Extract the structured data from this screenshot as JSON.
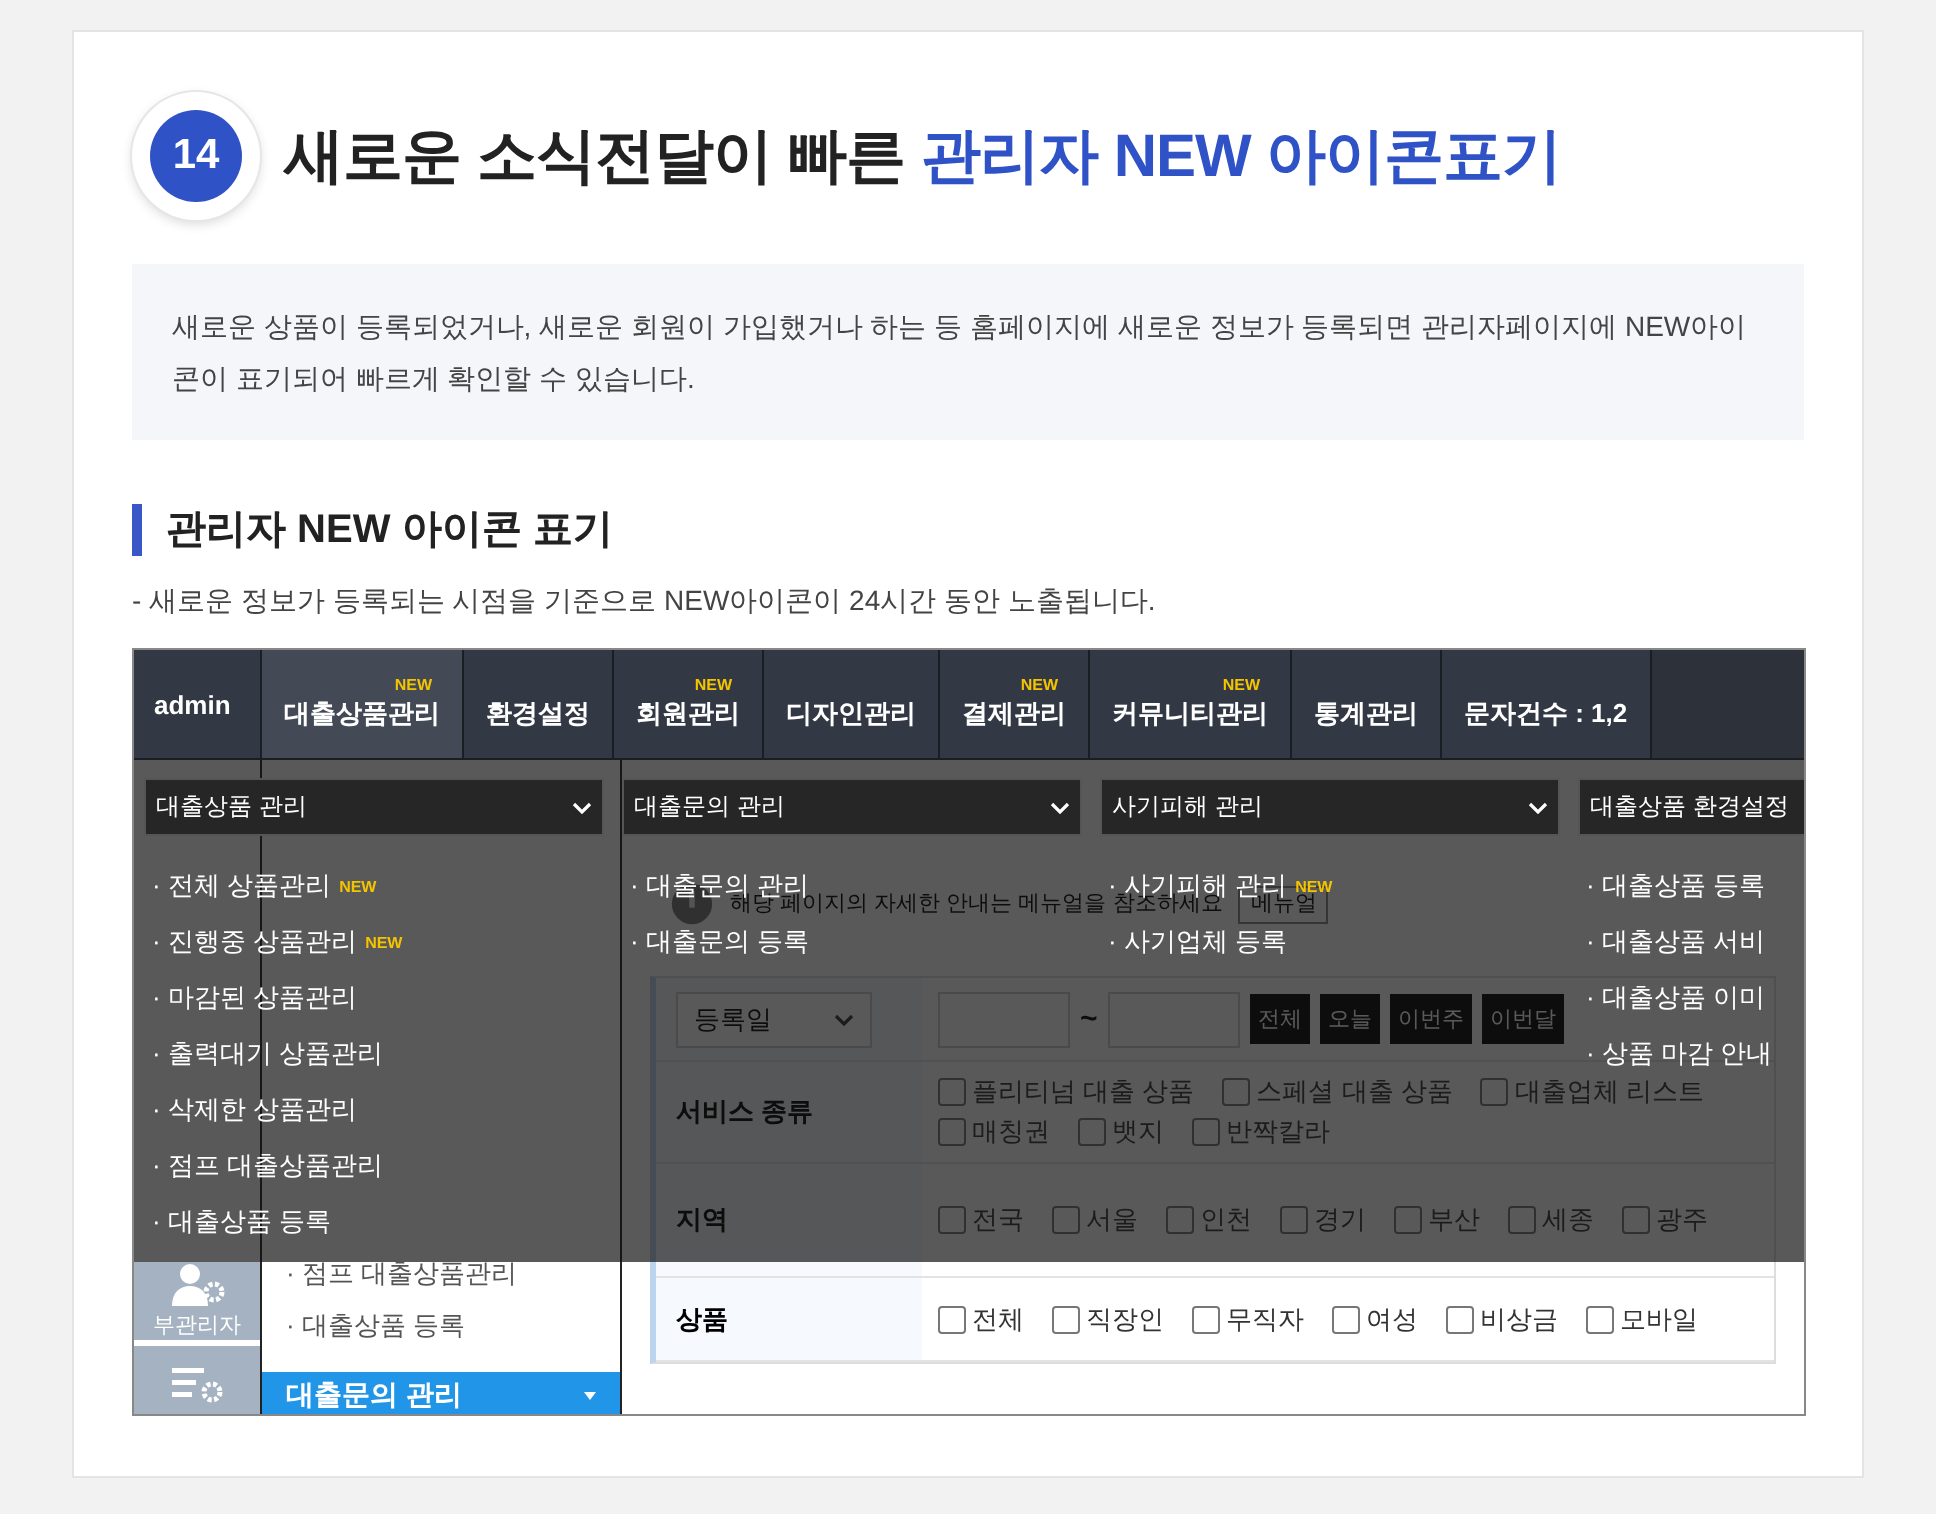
{
  "header": {
    "number": "14",
    "title": "새로운 소식전달이 빠른",
    "title_highlight": "관리자 NEW 아이콘표기"
  },
  "intro": "새로운 상품이 등록되었거나, 새로운 회원이 가입했거나 하는 등 홈페이지에 새로운 정보가 등록되면 관리자페이지에 NEW아이콘이 표기되어 빠르게 확인할 수 있습니다.",
  "section": {
    "heading": "관리자 NEW 아이콘 표기",
    "note": "- 새로운 정보가 등록되는 시점을 기준으로 NEW아이콘이 24시간 동안 노출됩니다."
  },
  "admin_screen": {
    "nav": [
      {
        "label": "admin",
        "kind": "logo",
        "selected": false
      },
      {
        "label": "대출상품관리",
        "kind": "menu",
        "badge": "NEW",
        "selected": true
      },
      {
        "label": "환경설정",
        "kind": "menu",
        "selected": false
      },
      {
        "label": "회원관리",
        "kind": "menu",
        "badge": "NEW",
        "selected": false
      },
      {
        "label": "디자인관리",
        "kind": "menu",
        "selected": false
      },
      {
        "label": "결제관리",
        "kind": "menu",
        "badge": "NEW",
        "selected": false
      },
      {
        "label": "커뮤니티관리",
        "kind": "menu",
        "badge": "NEW",
        "selected": false
      },
      {
        "label": "통계관리",
        "kind": "menu",
        "selected": false
      },
      {
        "label": "문자건수 : 1,2",
        "kind": "menu",
        "selected": false
      }
    ],
    "side_icons": [
      {
        "label": "부관리자",
        "kind": "admin"
      },
      {
        "kind": "settings-list"
      }
    ],
    "sidebar": {
      "items": [
        "· 점프 대출상품관리",
        "· 대출상품 등록"
      ],
      "group": "대출문의 관리"
    },
    "guide": {
      "text": "해당 페이지의 자세한 안내는 메뉴얼을 참조하세요",
      "button": "메뉴얼"
    },
    "form": [
      {
        "kind": "date",
        "select": "등록일",
        "separator": "~",
        "buttons": [
          "전체",
          "오늘",
          "이번주",
          "이번달"
        ]
      },
      {
        "kind": "checks",
        "label": "서비스 종류",
        "options": [
          {
            "label": "플리티넘 대출 상품",
            "checked": false
          },
          {
            "label": "스페셜 대출 상품",
            "checked": false
          },
          {
            "label": "대출업체 리스트",
            "checked": false
          },
          {
            "label": "매칭권",
            "checked": false
          },
          {
            "label": "뱃지",
            "checked": false
          },
          {
            "label": "반짝칼라",
            "checked": false
          }
        ]
      },
      {
        "kind": "checks",
        "label": "지역",
        "options": [
          {
            "label": "전국",
            "checked": false
          },
          {
            "label": "서울",
            "checked": false
          },
          {
            "label": "인천",
            "checked": false
          },
          {
            "label": "경기",
            "checked": false
          },
          {
            "label": "부산",
            "checked": false
          },
          {
            "label": "세종",
            "checked": false
          },
          {
            "label": "광주",
            "checked": false
          }
        ]
      },
      {
        "kind": "checks",
        "label": "상품",
        "options": [
          {
            "label": "전체",
            "checked": false
          },
          {
            "label": "직장인",
            "checked": false
          },
          {
            "label": "무직자",
            "checked": false
          },
          {
            "label": "여성",
            "checked": false
          },
          {
            "label": "비상금",
            "checked": false
          },
          {
            "label": "모바일",
            "checked": false
          }
        ]
      }
    ],
    "menu_columns": [
      {
        "select": "대출상품 관리",
        "items": [
          {
            "label": "· 전체 상품관리",
            "badge": "NEW"
          },
          {
            "label": "· 진행중 상품관리",
            "badge": "NEW"
          },
          {
            "label": "· 마감된 상품관리"
          },
          {
            "label": "· 출력대기 상품관리"
          },
          {
            "label": "· 삭제한 상품관리"
          },
          {
            "label": "· 점프 대출상품관리"
          },
          {
            "label": "· 대출상품 등록"
          }
        ]
      },
      {
        "select": "대출문의 관리",
        "items": [
          {
            "label": "· 대출문의 관리"
          },
          {
            "label": "· 대출문의 등록"
          }
        ]
      },
      {
        "select": "사기피해 관리",
        "items": [
          {
            "label": "· 사기피해 관리",
            "badge": "NEW"
          },
          {
            "label": "· 사기업체 등록"
          }
        ]
      },
      {
        "select": "대출상품 환경설정",
        "items": [
          {
            "label": "· 대출상품 등록"
          },
          {
            "label": "· 대출상품 서비"
          },
          {
            "label": "· 대출상품 이미"
          },
          {
            "label": "· 상품 마감 안내"
          }
        ]
      }
    ]
  }
}
